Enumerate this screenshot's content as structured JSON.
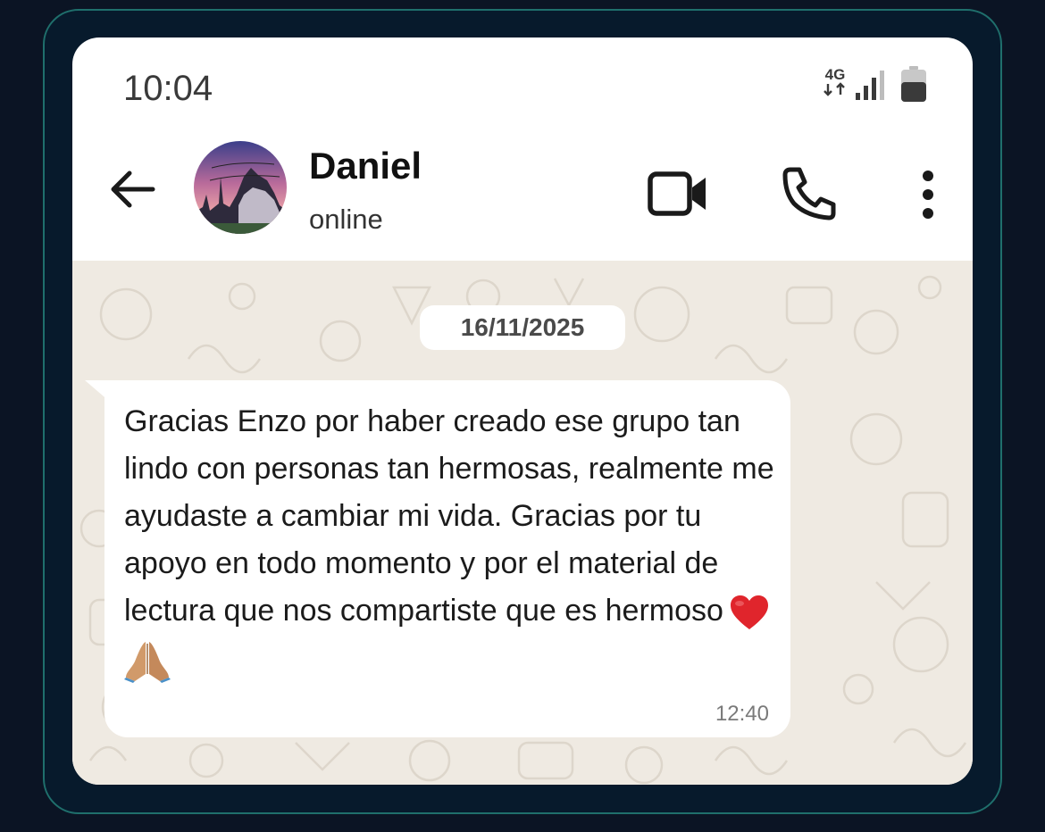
{
  "status_bar": {
    "time": "10:04",
    "network": "4G",
    "signal_icon": "signal-bars-icon",
    "battery_icon": "battery-icon"
  },
  "header": {
    "contact_name": "Daniel",
    "contact_status": "online",
    "back_icon": "arrow-left-icon",
    "video_icon": "video-camera-icon",
    "call_icon": "phone-icon",
    "menu_icon": "more-vertical-icon"
  },
  "chat": {
    "date": "16/11/2025",
    "message": {
      "text": "Gracias Enzo por haber creado ese grupo tan lindo con personas tan hermosas, realmente me ayudaste a cambiar mi vida. Gracias por tu apoyo en todo momento y por el material de lectura que nos compartiste que es hermoso",
      "emojis": [
        "heart-icon",
        "praying-hands-icon"
      ],
      "time": "12:40"
    }
  },
  "colors": {
    "background": "#0b1424",
    "frame_border": "#1f6f6c",
    "chat_background": "#efeae2",
    "bubble": "#ffffff",
    "heart": "#e0252c"
  }
}
